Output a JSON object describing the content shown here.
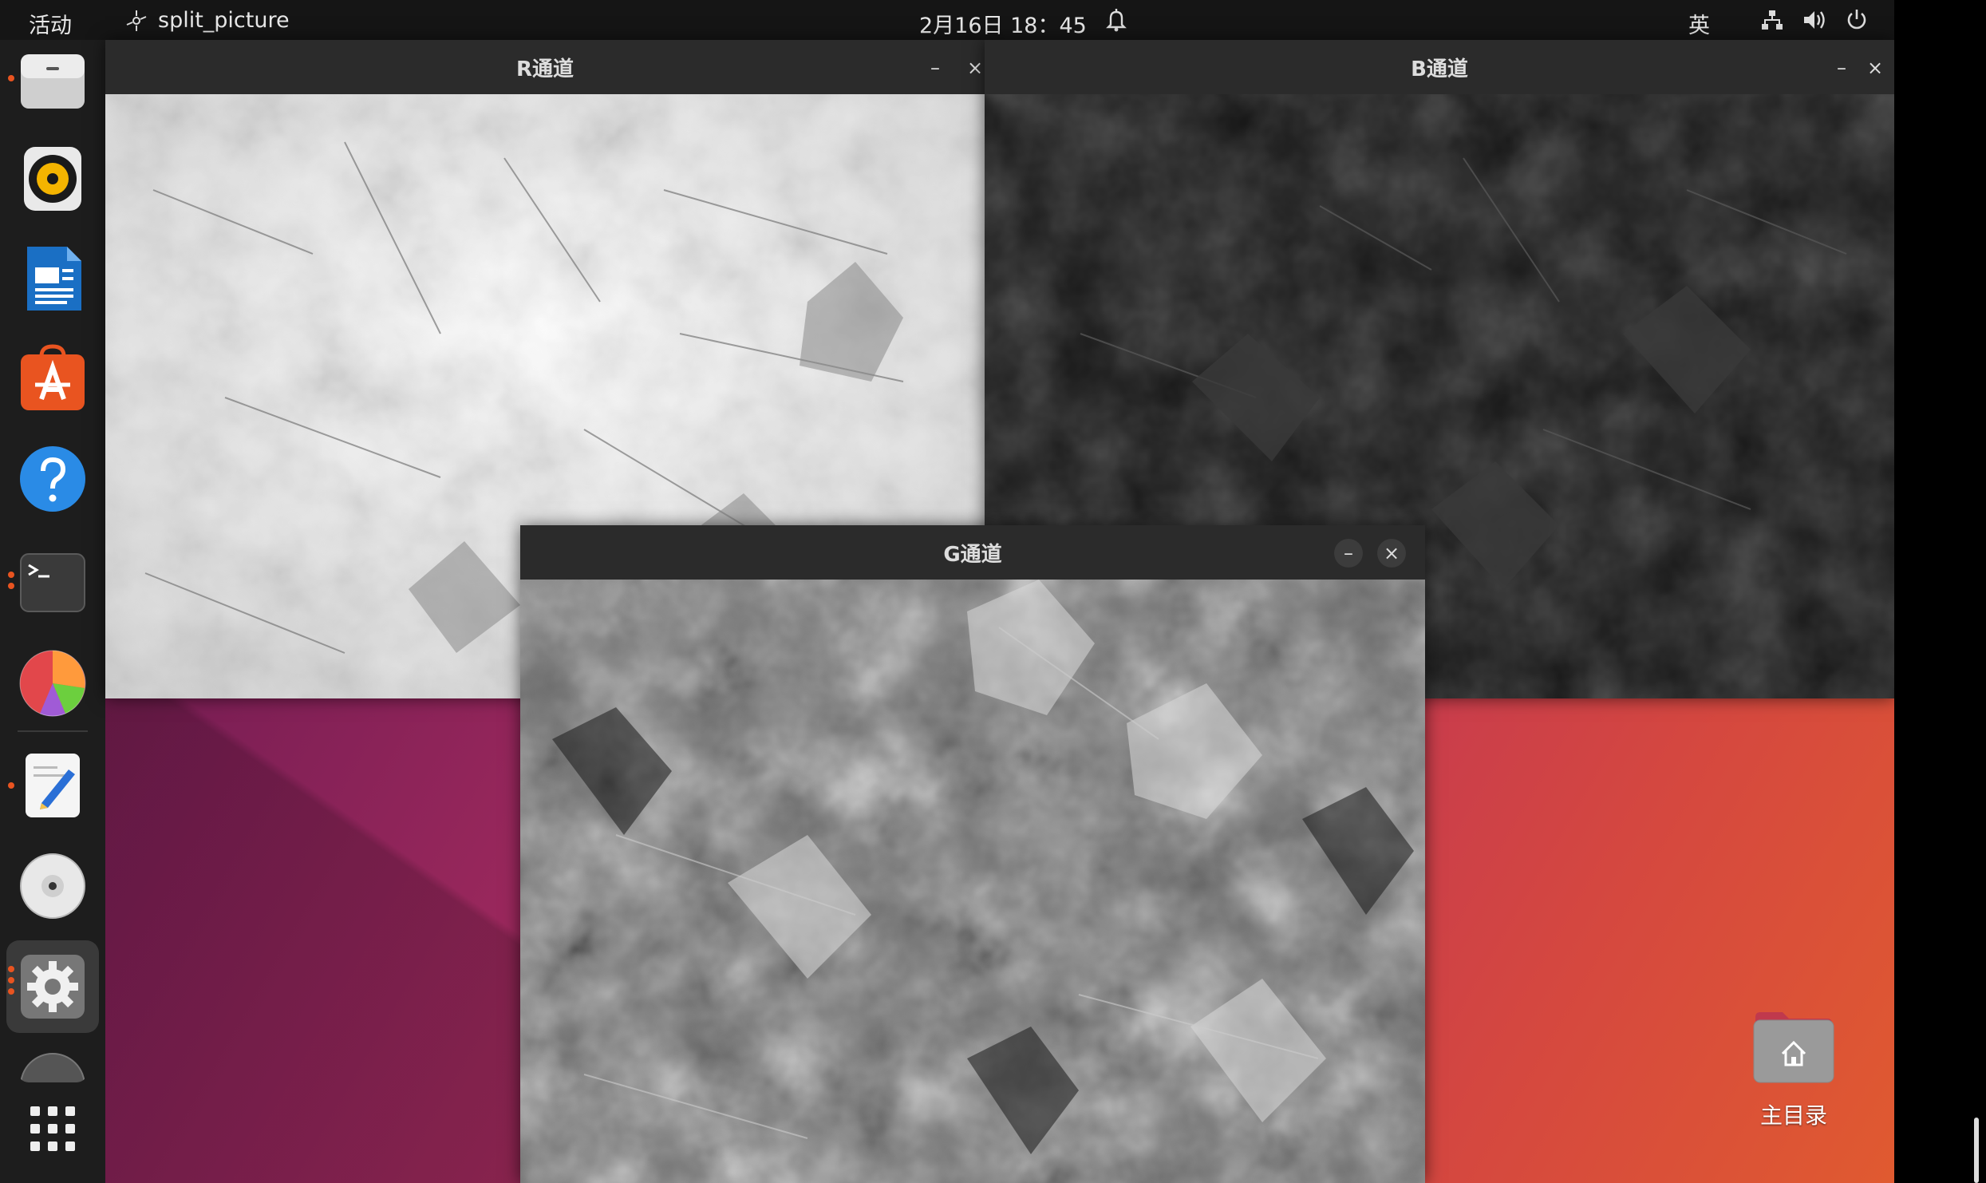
{
  "topbar": {
    "activities": "活动",
    "app_name": "split_picture",
    "clock": "2月16日 18：45",
    "input_method": "英"
  },
  "windows": {
    "r_channel": {
      "title": "R通道",
      "min": "–",
      "close": "×"
    },
    "b_channel": {
      "title": "B通道",
      "min": "–",
      "close": "×"
    },
    "g_channel": {
      "title": "G通道",
      "min": "–",
      "close": "×"
    }
  },
  "desktop": {
    "home_label": "主目录"
  },
  "dock": {
    "items": [
      "files-icon",
      "rhythmbox-icon",
      "libreoffice-writer-icon",
      "app-center-icon",
      "help-icon",
      "terminal-icon",
      "disk-usage-icon",
      "text-editor-icon",
      "disc-icon",
      "settings-icon",
      "trash-icon",
      "show-apps-icon"
    ]
  },
  "colors": {
    "accent": "#e95420",
    "topbar": "#151515",
    "dock": "#1d1d1d",
    "titlebar": "#2b2b2b"
  }
}
